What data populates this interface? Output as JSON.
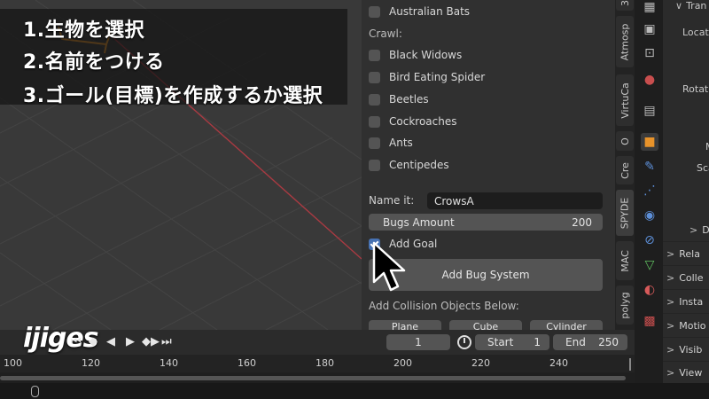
{
  "overlay": {
    "steps": [
      "1.生物を選択",
      "2.名前をつける",
      "3.ゴール(目標)を作成するか選択"
    ],
    "watermark": "ijiges"
  },
  "panel": {
    "top_item": "Australian Bats",
    "crawl_label": "Crawl:",
    "crawl_items": [
      "Black Widows",
      "Bird Eating Spider",
      "Beetles",
      "Cockroaches",
      "Ants",
      "Centipedes"
    ],
    "name_label": "Name it:",
    "name_value": "CrowsA",
    "bugs_amount_label": "Bugs Amount",
    "bugs_amount_value": "200",
    "add_goal_label": "Add Goal",
    "add_goal_checked": true,
    "add_bug_system_label": "Add Bug System",
    "collision_label": "Add Collision Objects Below:",
    "collision_buttons": [
      "Plane",
      "Cube",
      "Cylinder"
    ]
  },
  "tabs": [
    "3",
    "Atmosp",
    "VirtuCa",
    "O",
    "Cre",
    "SPYDE",
    "MAC",
    "polyg"
  ],
  "active_tab": "SPYDE",
  "properties_icons": [
    "tool-icon",
    "render-icon",
    "output-icon",
    "view-layer-icon",
    "scene-icon",
    "world-icon",
    "collection-icon",
    "object-icon",
    "modifier-icon",
    "particles-icon",
    "physics-icon",
    "constraints-icon",
    "data-icon",
    "material-icon",
    "texture-icon"
  ],
  "right_column": {
    "header": "Tran",
    "location": "Locati",
    "rotation": "Rotati",
    "mode": "M",
    "scale": "Sca",
    "delta": "D",
    "sections": [
      "Rela",
      "Colle",
      "Insta",
      "Motio",
      "Visib",
      "View"
    ]
  },
  "timeline": {
    "current_frame": "1",
    "start_label": "Start",
    "start_value": "1",
    "end_label": "End",
    "end_value": "250",
    "ticks": [
      "100",
      "120",
      "140",
      "160",
      "180",
      "200",
      "220",
      "240"
    ]
  },
  "colors": {
    "accent": "#4772b3",
    "selection_outline": "#e8932a",
    "x_axis": "#a93a42"
  }
}
